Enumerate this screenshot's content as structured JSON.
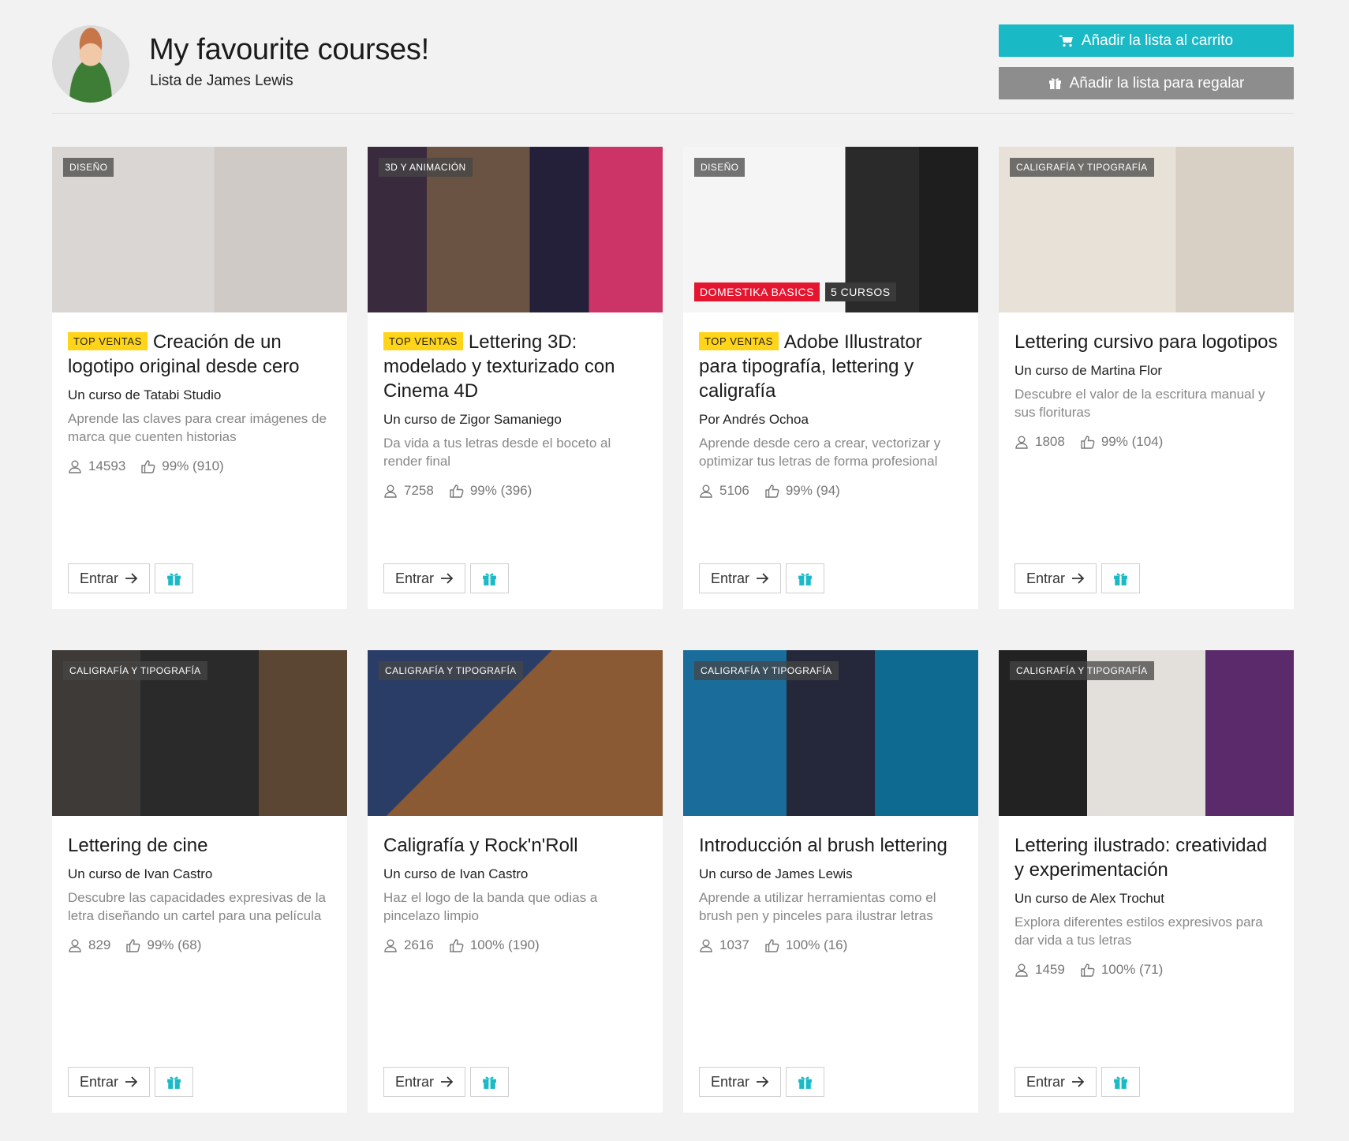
{
  "header": {
    "title": "My favourite courses!",
    "subtitle_prefix": "Lista de ",
    "owner": "James Lewis",
    "cart_button": "Añadir la lista al carrito",
    "gift_button": "Añadir la lista para regalar"
  },
  "colors": {
    "accent": "#1ab9c6",
    "gray_button": "#8d8d8d",
    "top_badge": "#ffd419",
    "basics_badge": "#e3152f"
  },
  "enter_label": "Entrar",
  "cards": [
    {
      "category": "DISEÑO",
      "top": "TOP VENTAS",
      "title": "Creación de un logotipo original desde cero",
      "author": "Un curso de Tatabi Studio",
      "desc": "Aprende las claves para crear imágenes de marca que cuenten historias",
      "students": "14593",
      "rating": "99% (910)"
    },
    {
      "category": "3D Y ANIMACIÓN",
      "top": "TOP VENTAS",
      "title": "Lettering 3D: modelado y texturizado con Cinema 4D",
      "author": "Un curso de Zigor Samaniego",
      "desc": "Da vida a tus letras desde el boceto al render final",
      "students": "7258",
      "rating": "99% (396)"
    },
    {
      "category": "DISEÑO",
      "top": "TOP VENTAS",
      "title": "Adobe Illustrator para tipografía, lettering y caligrafía",
      "author": "Por Andrés Ochoa",
      "desc": "Aprende desde cero a crear, vectorizar y optimizar tus letras de forma profesional",
      "students": "5106",
      "rating": "99% (94)",
      "basics": "DOMESTIKA BASICS",
      "count": "5 CURSOS"
    },
    {
      "category": "CALIGRAFÍA Y TIPOGRAFÍA",
      "top": "",
      "title": "Lettering cursivo para logotipos",
      "author": "Un curso de Martina Flor",
      "desc": "Descubre el valor de la escritura manual y sus florituras",
      "students": "1808",
      "rating": "99% (104)"
    },
    {
      "category": "CALIGRAFÍA Y TIPOGRAFÍA",
      "top": "",
      "title": "Lettering de cine",
      "author": "Un curso de Ivan Castro",
      "desc": "Descubre las capacidades expresivas de la letra diseñando un cartel para una película",
      "students": "829",
      "rating": "99% (68)"
    },
    {
      "category": "CALIGRAFÍA Y TIPOGRAFÍA",
      "top": "",
      "title": "Caligrafía y Rock'n'Roll",
      "author": "Un curso de Ivan Castro",
      "desc": "Haz el logo de la banda que odias a pincelazo limpio",
      "students": "2616",
      "rating": "100% (190)"
    },
    {
      "category": "CALIGRAFÍA Y TIPOGRAFÍA",
      "top": "",
      "title": "Introducción al brush lettering",
      "author": "Un curso de James Lewis",
      "desc": "Aprende a utilizar herramientas como el brush pen y pinceles para ilustrar letras",
      "students": "1037",
      "rating": "100% (16)"
    },
    {
      "category": "CALIGRAFÍA Y TIPOGRAFÍA",
      "top": "",
      "title": "Lettering ilustrado: creatividad y experimentación",
      "author": "Un curso de Alex Trochut",
      "desc": "Explora diferentes estilos expresivos para dar vida a tus letras",
      "students": "1459",
      "rating": "100% (71)"
    }
  ]
}
